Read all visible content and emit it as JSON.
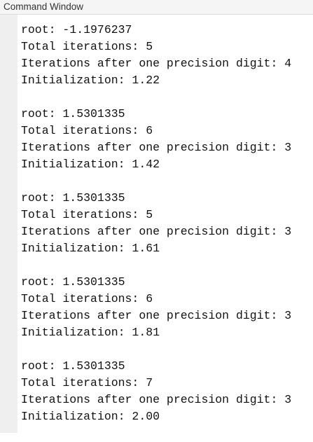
{
  "window": {
    "title": "Command Window"
  },
  "blocks": [
    {
      "root": "root: -1.1976237",
      "total": "Total iterations: 5",
      "after": "Iterations after one precision digit: 4",
      "init": "Initialization: 1.22"
    },
    {
      "root": "root: 1.5301335",
      "total": "Total iterations: 6",
      "after": "Iterations after one precision digit: 3",
      "init": "Initialization: 1.42"
    },
    {
      "root": "root: 1.5301335",
      "total": "Total iterations: 5",
      "after": "Iterations after one precision digit: 3",
      "init": "Initialization: 1.61"
    },
    {
      "root": "root: 1.5301335",
      "total": "Total iterations: 6",
      "after": "Iterations after one precision digit: 3",
      "init": "Initialization: 1.81"
    },
    {
      "root": "root: 1.5301335",
      "total": "Total iterations: 7",
      "after": "Iterations after one precision digit: 3",
      "init": "Initialization: 2.00"
    }
  ]
}
